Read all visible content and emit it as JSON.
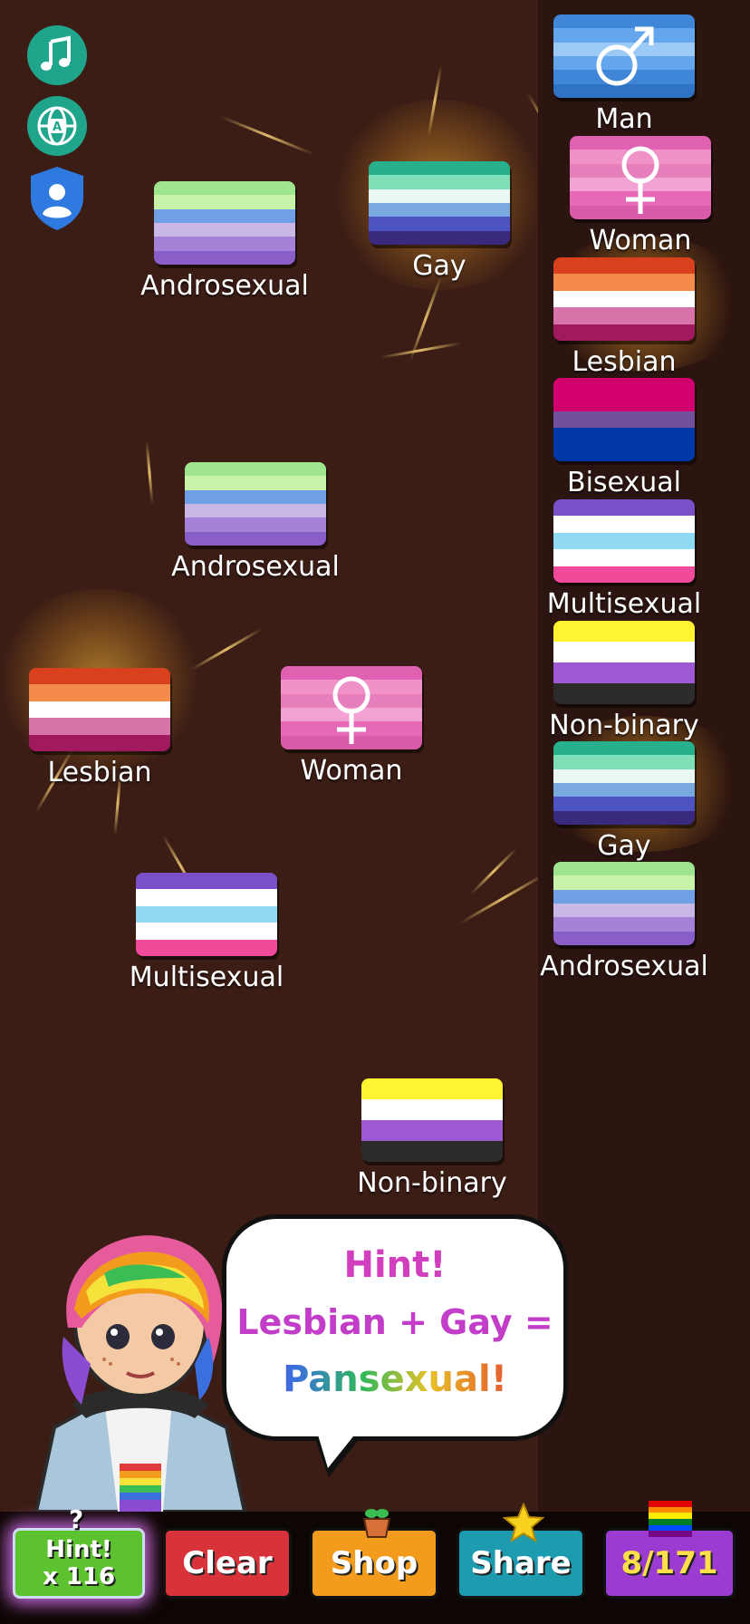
{
  "board_tokens": [
    {
      "name": "androsexual",
      "label": "Androsexual"
    },
    {
      "name": "gay",
      "label": "Gay"
    },
    {
      "name": "androsexual",
      "label": "Androsexual"
    },
    {
      "name": "lesbian",
      "label": "Lesbian"
    },
    {
      "name": "woman",
      "label": "Woman"
    },
    {
      "name": "multisexual",
      "label": "Multisexual"
    },
    {
      "name": "non-binary",
      "label": "Non-binary"
    }
  ],
  "sidebar_tokens": [
    {
      "name": "man",
      "label": "Man"
    },
    {
      "name": "woman",
      "label": "Woman"
    },
    {
      "name": "lesbian",
      "label": "Lesbian"
    },
    {
      "name": "bisexual",
      "label": "Bisexual"
    },
    {
      "name": "multisexual",
      "label": "Multisexual"
    },
    {
      "name": "non-binary",
      "label": "Non-binary"
    },
    {
      "name": "gay",
      "label": "Gay"
    },
    {
      "name": "androsexual",
      "label": "Androsexual"
    }
  ],
  "flag_colors": {
    "androsexual": [
      "#9fe58d",
      "#c8f2a8",
      "#6fa0e6",
      "#c9b8e6",
      "#a582d8",
      "#8a5ec9"
    ],
    "gay": [
      "#27b08c",
      "#7fe0b7",
      "#e9f6f1",
      "#7aa9e0",
      "#4d53c1",
      "#3a2a7e"
    ],
    "lesbian": [
      "#d9401d",
      "#f58b4b",
      "#ffffff",
      "#d874a9",
      "#a1195f"
    ],
    "woman": [
      "#e060b2",
      "#f091c8",
      "#e77fbd",
      "#f3a3d3",
      "#e668b6",
      "#d95aa8"
    ],
    "man": [
      "#3f86d8",
      "#63a6ee",
      "#9ccaf7",
      "#63a6ee",
      "#3f86d8",
      "#2f74c4"
    ],
    "bisexual": [
      "#d2006f",
      "#d2006f",
      "#73509b",
      "#0038a8",
      "#0038a8"
    ],
    "multisexual": [
      "#7b4fc8",
      "#ffffff",
      "#8fd9f2",
      "#ffffff",
      "#f04a9a"
    ],
    "non-binary": [
      "#fff431",
      "#ffffff",
      "#9c59d1",
      "#2c2c2c"
    ]
  },
  "top_icons": [
    {
      "name": "music-note-icon"
    },
    {
      "name": "globe-language-icon",
      "glyph": "A"
    },
    {
      "name": "shield-user-icon"
    }
  ],
  "hint_bubble": {
    "line1": "Hint!",
    "line2": "Lesbian + Gay =",
    "line3": "Pansexual!"
  },
  "bottom_buttons": {
    "hint_label": "Hint!",
    "hint_count": "x 116",
    "clear": "Clear",
    "shop": "Shop",
    "share": "Share",
    "progress": "8/171"
  },
  "colors": {
    "board_bg": "#3b1d15",
    "sidebar_bg": "#2c1510",
    "hint_green": "#5cc230",
    "clear_red": "#d8323b",
    "shop_orange": "#f29b1c",
    "share_teal": "#1f9bb0",
    "count_purple": "#9b3bd1"
  }
}
